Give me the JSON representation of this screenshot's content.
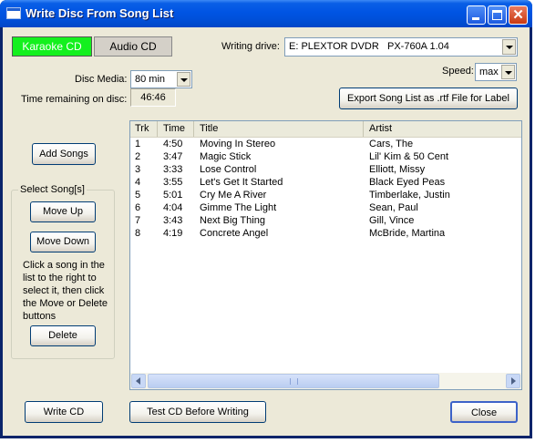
{
  "window": {
    "title": "Write Disc From Song List"
  },
  "mode_tabs": {
    "karaoke": "Karaoke CD",
    "audio": "Audio CD"
  },
  "drive": {
    "label": "Writing drive:",
    "value": "E: PLEXTOR DVDR   PX-760A 1.04"
  },
  "speed": {
    "label": "Speed:",
    "value": "max"
  },
  "media": {
    "label": "Disc Media:",
    "value": "80 min"
  },
  "time_remaining": {
    "label": "Time remaining on disc:",
    "value": "46:46"
  },
  "export_button": "Export Song List as .rtf File for Label",
  "add_songs_button": "Add Songs",
  "select_group": {
    "title": "Select Song[s]",
    "move_up": "Move Up",
    "move_down": "Move Down",
    "help_text": "Click a song in the list to the right to select it, then click the Move or Delete buttons",
    "delete": "Delete"
  },
  "song_table": {
    "columns": [
      "Trk",
      "Time",
      "Title",
      "Artist"
    ],
    "rows": [
      [
        "1",
        "4:50",
        "Moving In Stereo",
        "Cars, The"
      ],
      [
        "2",
        "3:47",
        "Magic Stick",
        "Lil' Kim & 50 Cent"
      ],
      [
        "3",
        "3:33",
        "Lose Control",
        "Elliott, Missy"
      ],
      [
        "4",
        "3:55",
        "Let's Get It Started",
        "Black Eyed Peas"
      ],
      [
        "5",
        "5:01",
        "Cry Me A River",
        "Timberlake, Justin"
      ],
      [
        "6",
        "4:04",
        "Gimme The Light",
        "Sean, Paul"
      ],
      [
        "7",
        "3:43",
        "Next Big Thing",
        "Gill, Vince"
      ],
      [
        "8",
        "4:19",
        "Concrete Angel",
        "McBride, Martina"
      ]
    ]
  },
  "bottom_buttons": {
    "write": "Write CD",
    "test": "Test CD Before Writing",
    "close": "Close"
  },
  "colors": {
    "karaoke_active": "#14f01e",
    "title_bar": "#0054e3",
    "face": "#ece9d8"
  }
}
